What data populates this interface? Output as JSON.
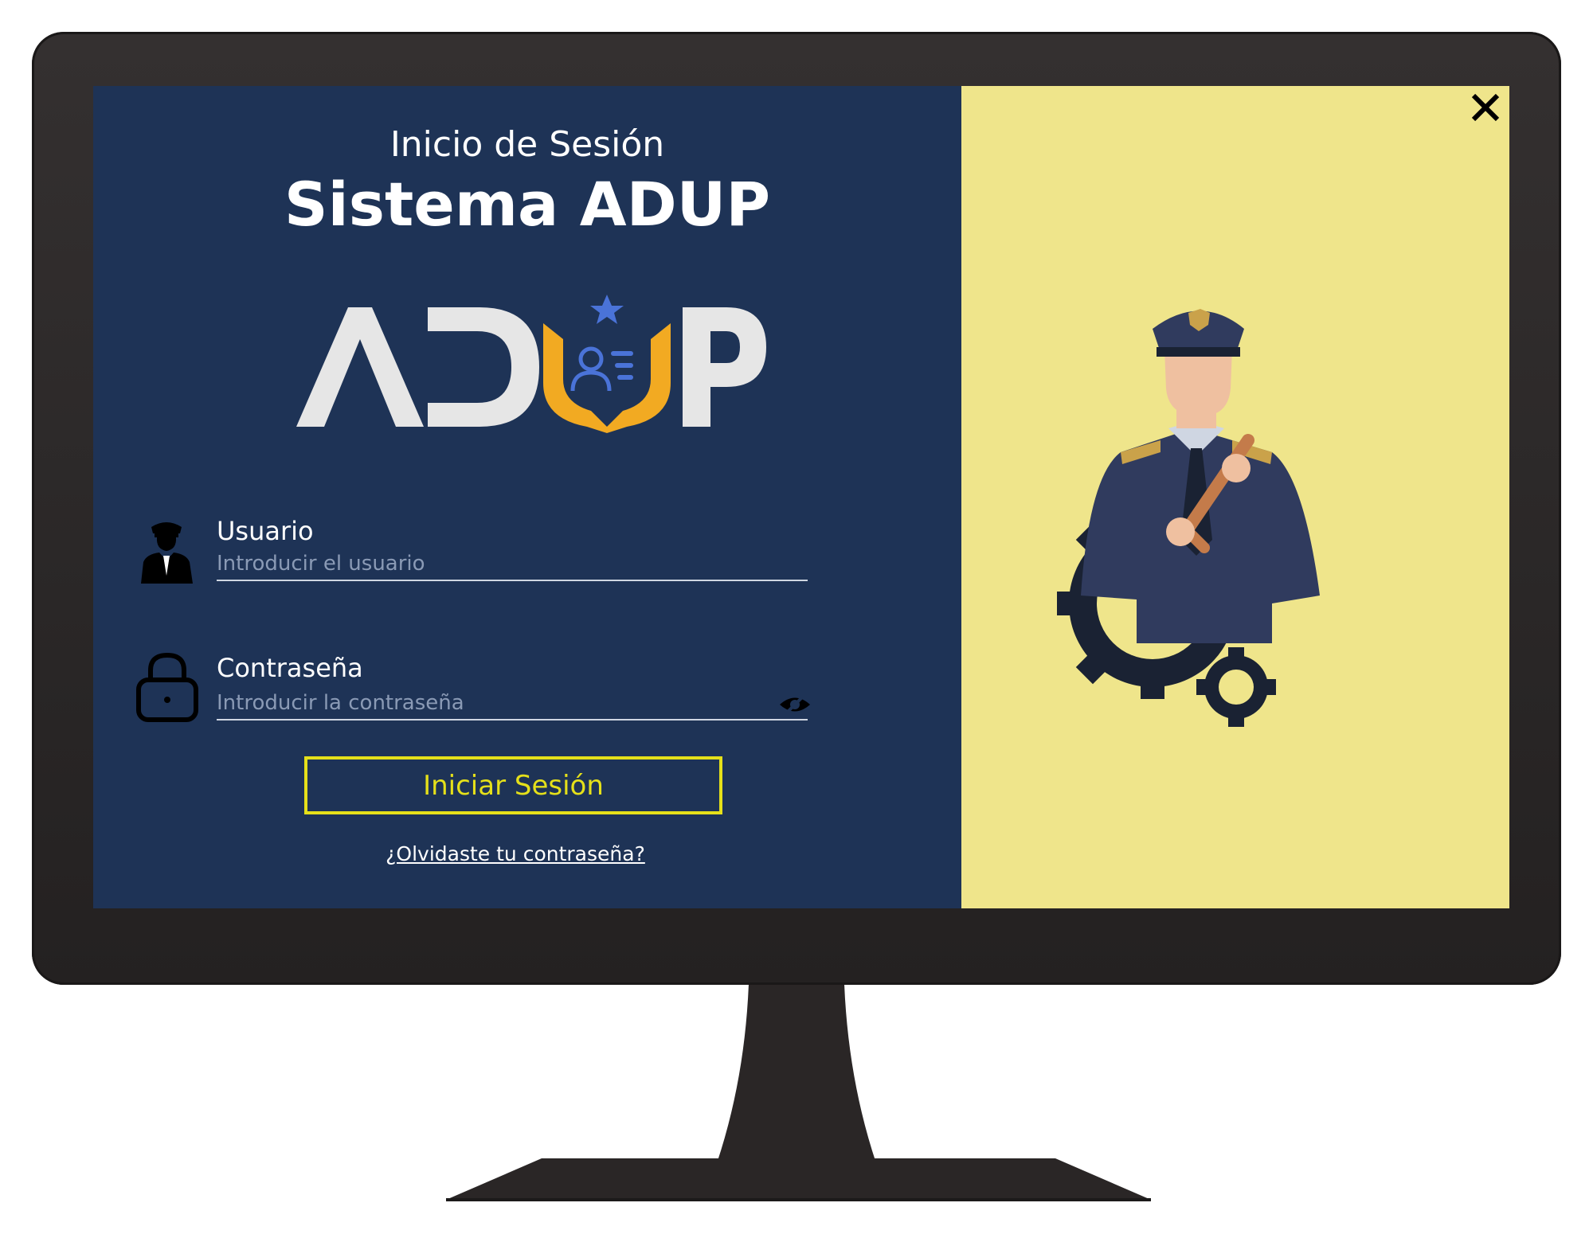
{
  "header": {
    "subtitle": "Inicio de Sesión",
    "title": "Sistema ADUP"
  },
  "logo": {
    "letters_left": "AD",
    "letters_right": "P",
    "colors": {
      "letters": "#e6e6e6",
      "shield": "#f2aa22",
      "star": "#4a73d8",
      "person": "#4a73d8"
    }
  },
  "form": {
    "user": {
      "label": "Usuario",
      "placeholder": "Introducir el usuario",
      "value": ""
    },
    "password": {
      "label": "Contraseña",
      "placeholder": "Introducir la contraseña",
      "value": ""
    },
    "submit_label": "Iniciar Sesión",
    "forgot_label": "¿Olvidaste tu contraseña?"
  },
  "icons": {
    "close": "close-icon",
    "user": "police-officer-icon",
    "lock": "lock-icon",
    "eye": "eye-slash-icon"
  },
  "colors": {
    "left_panel": "#1e3356",
    "right_panel": "#efe58b",
    "button_accent": "#e5e01a",
    "bezel": "#2c2929"
  }
}
